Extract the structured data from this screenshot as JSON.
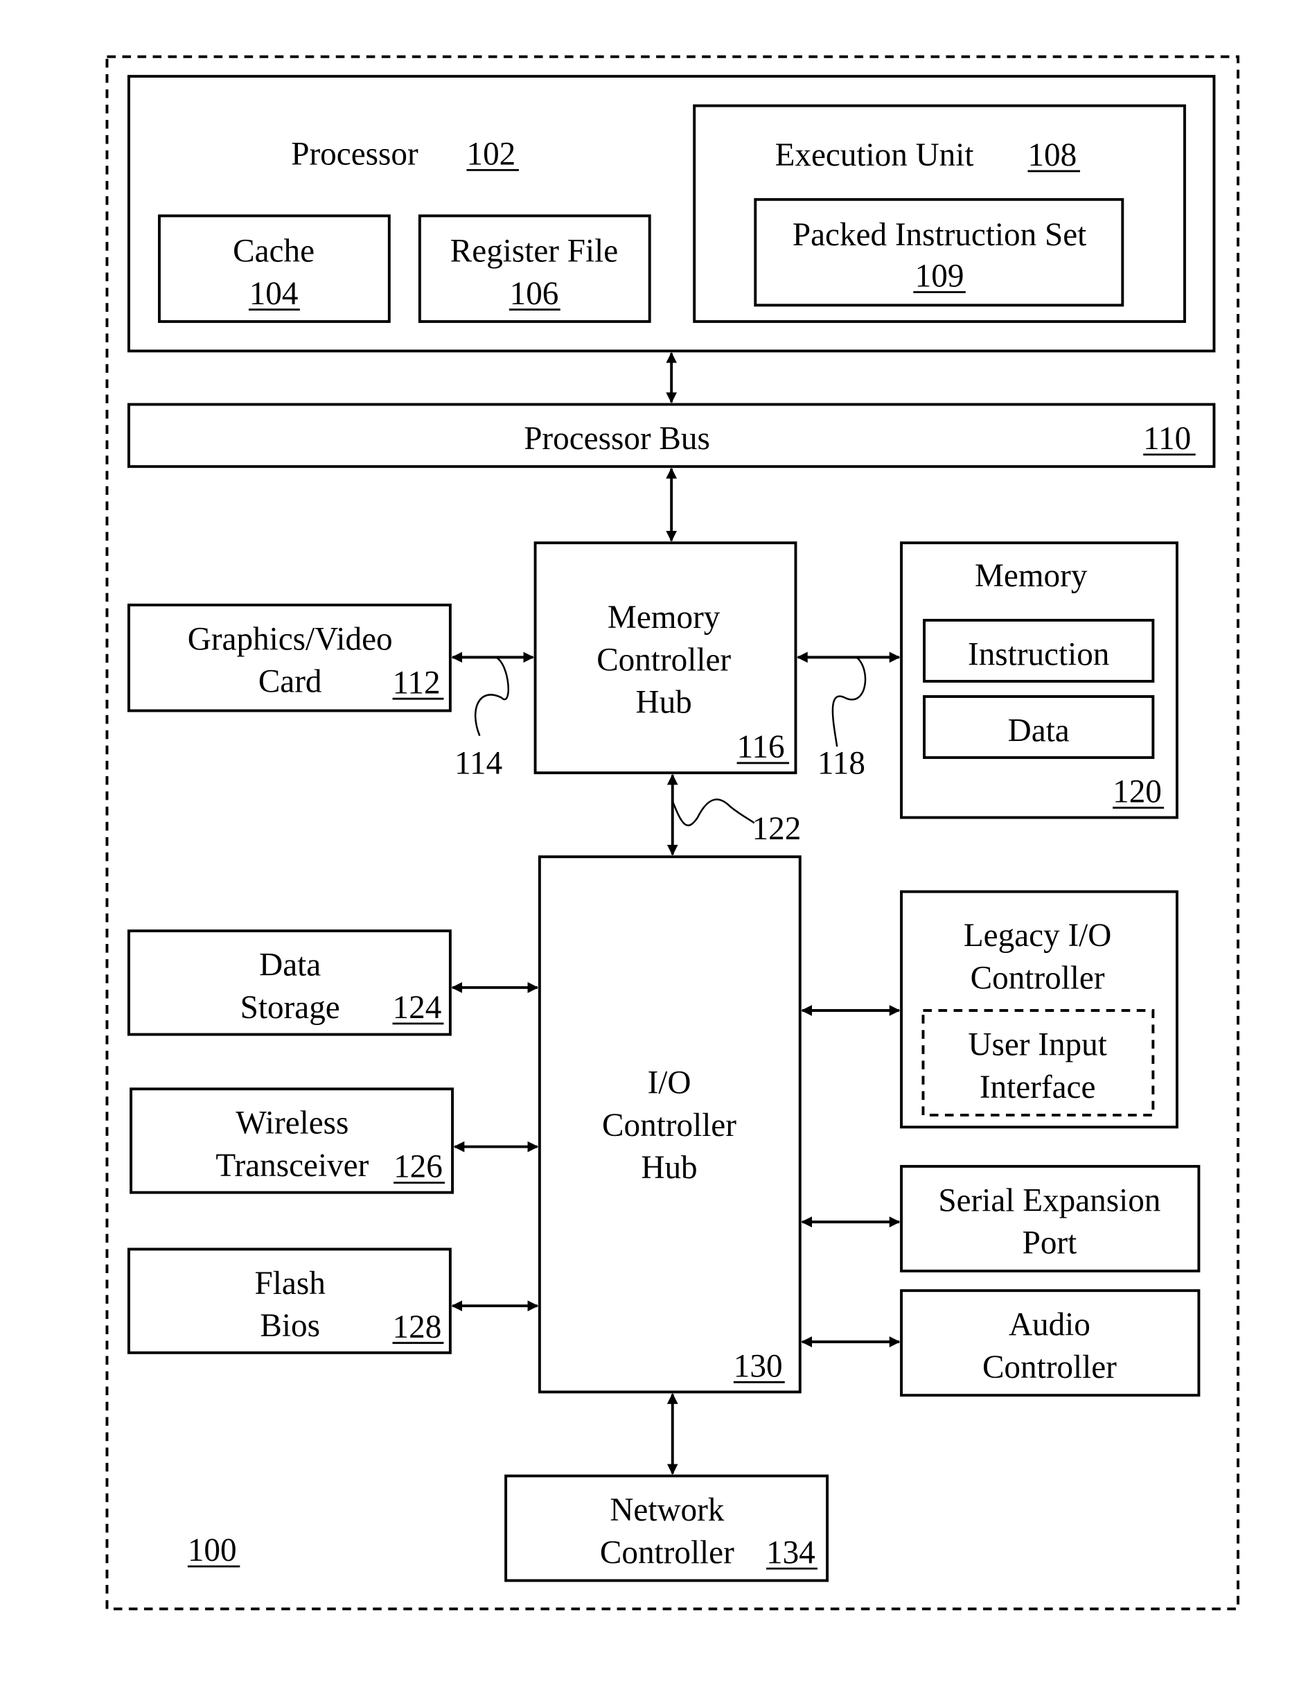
{
  "diagram": {
    "system": {
      "ref": "100"
    },
    "processor": {
      "label": "Processor",
      "ref": "102"
    },
    "cache": {
      "label": "Cache",
      "ref": "104"
    },
    "register_file": {
      "label": "Register File",
      "ref": "106"
    },
    "execution_unit": {
      "label": "Execution Unit",
      "ref": "108"
    },
    "packed_instruction_set": {
      "label": "Packed Instruction Set",
      "ref": "109"
    },
    "processor_bus": {
      "label": "Processor Bus",
      "ref": "110"
    },
    "graphics_card": {
      "label_line1": "Graphics/Video",
      "label_line2": "Card",
      "ref": "112"
    },
    "link_114": {
      "ref": "114"
    },
    "mch": {
      "label_line1": "Memory",
      "label_line2": "Controller",
      "label_line3": "Hub",
      "ref": "116"
    },
    "link_118": {
      "ref": "118"
    },
    "memory": {
      "label": "Memory",
      "instruction": "Instruction",
      "data": "Data",
      "ref": "120"
    },
    "link_122": {
      "ref": "122"
    },
    "data_storage": {
      "label_line1": "Data",
      "label_line2": "Storage",
      "ref": "124"
    },
    "wireless": {
      "label_line1": "Wireless",
      "label_line2": "Transceiver",
      "ref": "126"
    },
    "flash_bios": {
      "label_line1": "Flash",
      "label_line2": "Bios",
      "ref": "128"
    },
    "ich": {
      "label_line1": "I/O",
      "label_line2": "Controller",
      "label_line3": "Hub",
      "ref": "130"
    },
    "legacy_io": {
      "label_line1": "Legacy I/O",
      "label_line2": "Controller",
      "uii_line1": "User Input",
      "uii_line2": "Interface"
    },
    "serial_port": {
      "label_line1": "Serial Expansion",
      "label_line2": "Port"
    },
    "audio": {
      "label_line1": "Audio",
      "label_line2": "Controller"
    },
    "network": {
      "label_line1": "Network",
      "label_line2": "Controller",
      "ref": "134"
    }
  }
}
